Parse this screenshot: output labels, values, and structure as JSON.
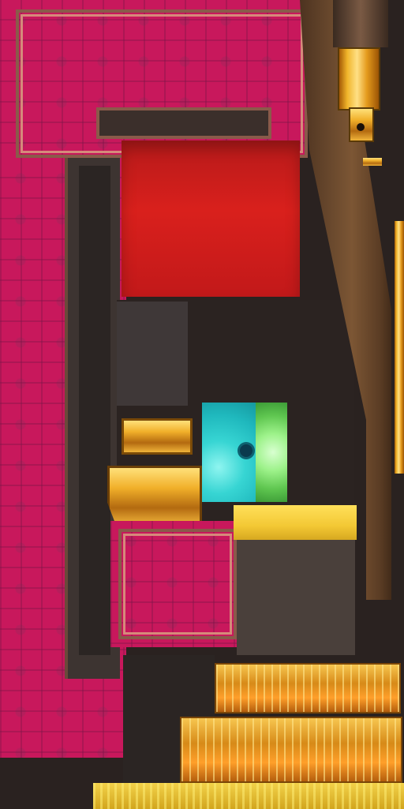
{
  "scene": {
    "palette": {
      "carpet": "#c8185c",
      "carpet_trim": "#d58a7a",
      "wall_dark": "#3d3431",
      "red_block": "#d9201c",
      "cyan_block": "#37d5d3",
      "green_block": "#9df28a",
      "gold": "#f1b02a",
      "yellow_top": "#f3c834",
      "wood": "#6b4a2e"
    },
    "icons": {
      "player_marker": "player-icon"
    }
  }
}
